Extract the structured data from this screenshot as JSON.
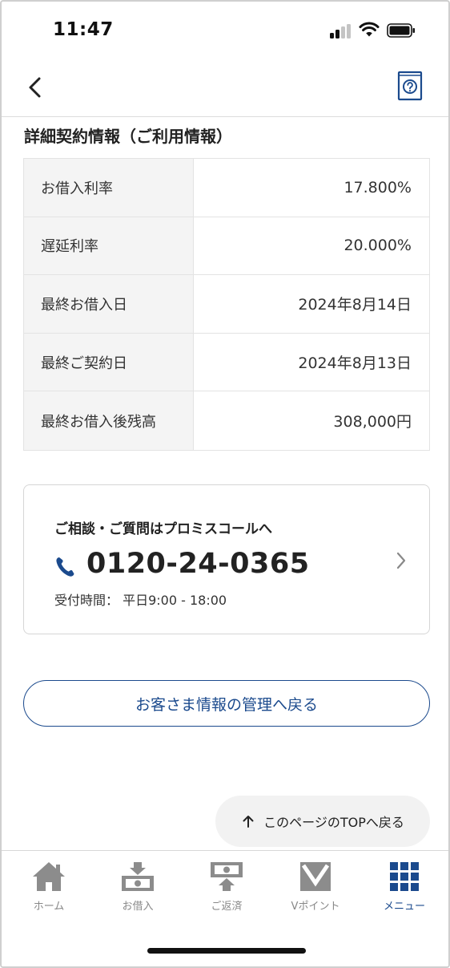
{
  "status_bar": {
    "time": "11:47"
  },
  "section": {
    "title": "詳細契約情報（ご利用情報）"
  },
  "info_rows": [
    {
      "label": "お借入利率",
      "value": "17.800%"
    },
    {
      "label": "遅延利率",
      "value": "20.000%"
    },
    {
      "label": "最終お借入日",
      "value": "2024年8月14日"
    },
    {
      "label": "最終ご契約日",
      "value": "2024年8月13日"
    },
    {
      "label": "最終お借入後残高",
      "value": "308,000円"
    }
  ],
  "call_card": {
    "heading": "ご相談・ご質問はプロミスコールへ",
    "phone_number": "0120-24-0365",
    "hours": "受付時間： 平日9:00 - 18:00"
  },
  "return_button": {
    "label": "お客さま情報の管理へ戻る"
  },
  "top_button": {
    "label": "このページのTOPへ戻る"
  },
  "tabs": [
    {
      "label": "ホーム",
      "icon": "home-icon"
    },
    {
      "label": "お借入",
      "icon": "borrow-icon"
    },
    {
      "label": "ご返済",
      "icon": "repay-icon"
    },
    {
      "label": "Vポイント",
      "icon": "vpoint-icon"
    },
    {
      "label": "メニュー",
      "icon": "menu-grid-icon"
    }
  ],
  "colors": {
    "accent": "#1b4a8d",
    "tab_inactive": "#888888",
    "table_label_bg": "#f4f4f4"
  }
}
